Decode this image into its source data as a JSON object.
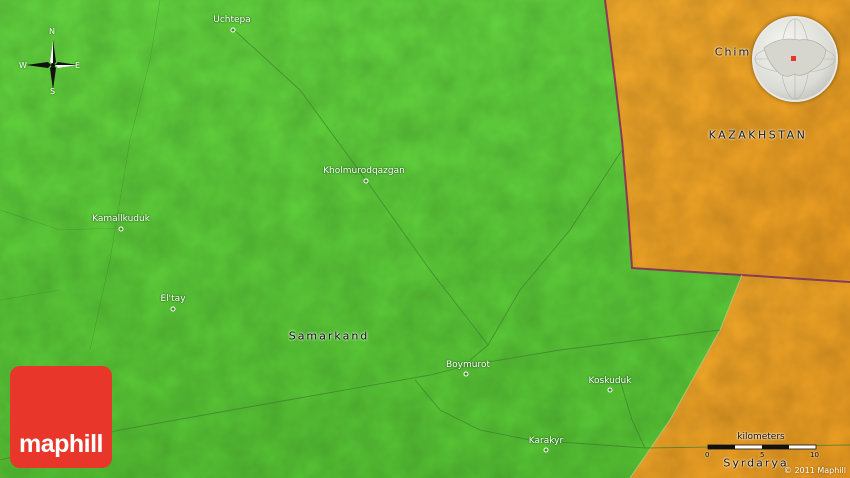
{
  "map": {
    "colors": {
      "uzbekistan": "#5fd23c",
      "kazakhstan": "#f0a829",
      "border": "#8a3a56",
      "road": "#4a8a3a",
      "logo": "#e8362a"
    },
    "places": [
      {
        "name": "Uchtepa"
      },
      {
        "name": "Kholmurodqazgan"
      },
      {
        "name": "Kamallkuduk"
      },
      {
        "name": "El'tay"
      },
      {
        "name": "Boymurot"
      },
      {
        "name": "Koskuduk"
      },
      {
        "name": "Karakyr"
      }
    ],
    "regions": {
      "samarkand": "Samarkand",
      "kazakhstan": "KAZAKHSTAN",
      "chim": "Chim",
      "syrdarya": "Syrdarya"
    },
    "compass": {
      "n": "N",
      "s": "S",
      "e": "E",
      "w": "W",
      "icon": "compass-rose-icon"
    },
    "globe": {
      "icon": "globe-locator-icon"
    },
    "logo": {
      "text": "maphill"
    },
    "scale": {
      "title": "kilometers",
      "ticks": [
        "0",
        "5",
        "10"
      ]
    },
    "copyright": "© 2011 Maphill"
  }
}
